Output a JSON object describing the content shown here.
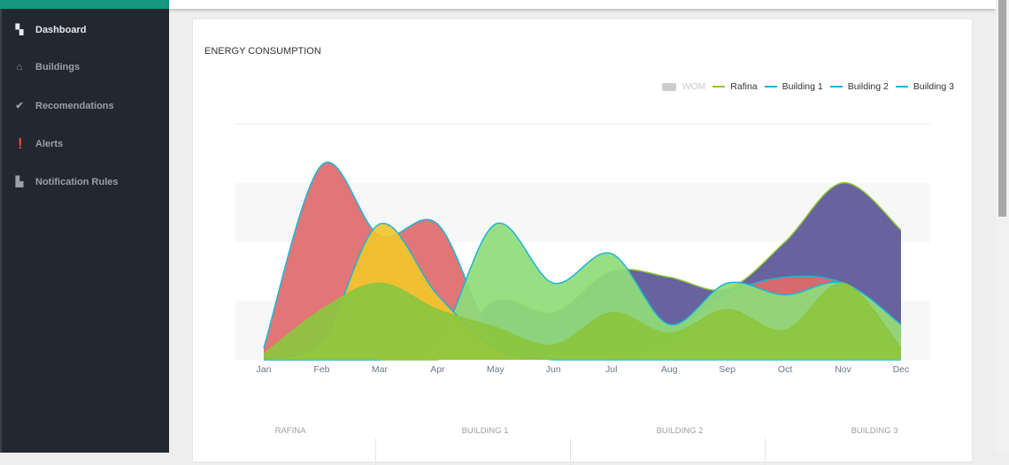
{
  "sidebar": {
    "items": [
      {
        "label": "Dashboard",
        "icon": "dashboard-icon",
        "glyph": "▚",
        "active": true
      },
      {
        "label": "Buildings",
        "icon": "home-icon",
        "glyph": "⌂"
      },
      {
        "label": "Recomendations",
        "icon": "check-icon",
        "glyph": "✔"
      },
      {
        "label": "Alerts",
        "icon": "alert-icon",
        "glyph": "❗"
      },
      {
        "label": "Notification Rules",
        "icon": "puzzle-icon",
        "glyph": "▙"
      }
    ]
  },
  "card": {
    "title": "ENERGY CONSUMPTION"
  },
  "legend": [
    {
      "label": "WOM",
      "color": "#cccccc",
      "disabled": true
    },
    {
      "label": "Rafina",
      "color": "#8cc63f"
    },
    {
      "label": "Building 1",
      "color": "#1cb5d8"
    },
    {
      "label": "Building 2",
      "color": "#1cb5d8"
    },
    {
      "label": "Building 3",
      "color": "#1cb5d8"
    }
  ],
  "table": {
    "columns": [
      "RAFINA",
      "BUILDING 1",
      "BUILDING 2",
      "BUILDING 3"
    ]
  },
  "chart_data": {
    "type": "area",
    "categories": [
      "Jan",
      "Feb",
      "Mar",
      "Apr",
      "May",
      "Jun",
      "Jul",
      "Aug",
      "Sep",
      "Oct",
      "Nov",
      "Dec"
    ],
    "grid": true,
    "legend_position": "top-right",
    "ylim": [
      0,
      4
    ],
    "series": [
      {
        "fill": "#5b5596",
        "stroke": "#8cc63f",
        "values": [
          0,
          0,
          0,
          0,
          1,
          0.8,
          1.5,
          1.4,
          1.2,
          2,
          3,
          2.2
        ]
      },
      {
        "fill": "#e06a6a",
        "stroke": "#1cb5d8",
        "values": [
          0.2,
          3.3,
          2.1,
          2.3,
          0.3,
          0.1,
          0.1,
          0.3,
          1.1,
          1.4,
          1.3,
          0.6
        ]
      },
      {
        "fill": "#8fdc7a",
        "stroke": "#1cb5d8",
        "values": [
          0,
          0,
          0,
          0.3,
          2.3,
          1.3,
          1.8,
          0.6,
          1.3,
          1.1,
          1.3,
          0.6
        ]
      },
      {
        "fill": "#f2c62c",
        "stroke": "#1cb5d8",
        "values": [
          0,
          0.3,
          2.3,
          1.1,
          0.2,
          0,
          0,
          0,
          0,
          0,
          0,
          0
        ]
      },
      {
        "fill": "#8cc63f",
        "stroke": "#8cc63f",
        "values": [
          0.1,
          0.85,
          1.3,
          0.85,
          0.55,
          0.25,
          0.8,
          0.45,
          0.85,
          0.5,
          1.3,
          0.2
        ]
      }
    ]
  }
}
